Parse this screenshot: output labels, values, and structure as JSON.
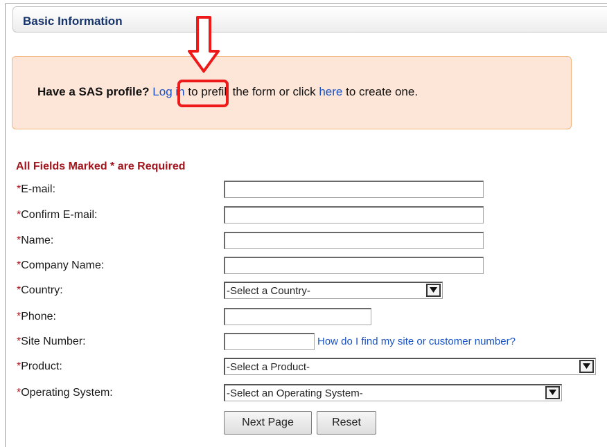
{
  "section": {
    "title": "Basic Information"
  },
  "notice": {
    "lead": "Have a SAS profile?",
    "login_link": "Log in",
    "middle": "to prefill the form or click",
    "here_link": "here",
    "tail": "to create one."
  },
  "form": {
    "required_note": "All Fields Marked * are Required",
    "required_marker": "*",
    "fields": [
      {
        "label": "E-mail:",
        "type": "text",
        "value": ""
      },
      {
        "label": "Confirm E-mail:",
        "type": "text",
        "value": ""
      },
      {
        "label": "Name:",
        "type": "text",
        "value": ""
      },
      {
        "label": "Company Name:",
        "type": "text",
        "value": ""
      },
      {
        "label": "Country:",
        "type": "select",
        "value": "-Select a Country-"
      },
      {
        "label": "Phone:",
        "type": "text",
        "value": ""
      },
      {
        "label": "Site Number:",
        "type": "text",
        "value": "",
        "help_link": "How do I find my site or customer number?"
      },
      {
        "label": "Product:",
        "type": "select",
        "value": "-Select a Product-"
      },
      {
        "label": "Operating System:",
        "type": "select",
        "value": "-Select an Operating System-"
      }
    ],
    "next_button": "Next Page",
    "reset_button": "Reset"
  },
  "colors": {
    "header_title": "#16346b",
    "link": "#1752c7",
    "required": "#a2141b",
    "notice_bg": "#fde6d8",
    "notice_border": "#f4b47e",
    "annotation": "#ee1a1a"
  },
  "icons": {
    "annotation_arrow": "down-arrow-icon",
    "select_arrow": "chevron-down-icon"
  }
}
